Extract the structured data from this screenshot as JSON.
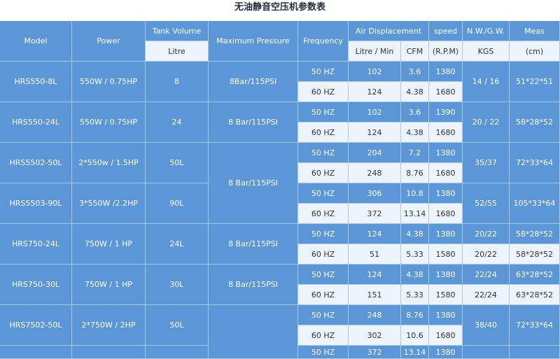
{
  "title": "无油静音空压机参数表",
  "headers": {
    "model": "Model",
    "power": "Power",
    "tank_volume": "Tank Volume",
    "tank_unit": "Litre",
    "max_pressure": "Maximum Pressure",
    "frequency": "Frequency",
    "air_displacement": "Air Displacement",
    "litre_min": "Litre / Min",
    "cfm": "CFM",
    "speed": "speed",
    "speed_unit": "(R.P.M)",
    "weight": "N.W./G.W.",
    "weight_unit": "KGS",
    "meas": "Meas",
    "meas_unit": "(cm)"
  },
  "models": [
    {
      "model": "HRS550-8L",
      "power": "550W / 0.75HP",
      "tank": "8",
      "pressure": "8Bar/115PSI",
      "weight": "14 / 16",
      "meas": "51*22*51"
    },
    {
      "model": "HRS550-24L",
      "power": "550W / 0.75HP",
      "tank": "24",
      "pressure": "8 Bar/115PSI",
      "weight": "20 / 22",
      "meas": "58*28*52"
    },
    {
      "model": "HRS5502-50L",
      "power": "2*550w / 1.5HP",
      "tank": "50L",
      "weight": "35/37",
      "meas": "72*33*64"
    },
    {
      "model": "HRS5503-90L",
      "power": "3*550W /2.2HP",
      "tank": "90L",
      "weight": "52/55",
      "meas": "105*33*64"
    },
    {
      "model": "HRS750-24L",
      "power": "750W / 1 HP",
      "tank": "24L",
      "pressure": "8 Bar/115PSI"
    },
    {
      "model": "HRS750-30L",
      "power": "750W / 1 HP",
      "tank": "30L",
      "pressure": "8 Bar/115PSI"
    },
    {
      "model": "HRS7502-50L",
      "power": "2*750W / 2HP",
      "tank": "50L",
      "weight": "38/40",
      "meas": "72*33*64"
    }
  ],
  "shared_pressure": "8 Bar/115PSI",
  "rows": [
    {
      "freq": "50 HZ",
      "lmin": "102",
      "cfm": "3.6",
      "rpm": "1380"
    },
    {
      "freq": "60 HZ",
      "lmin": "124",
      "cfm": "4.38",
      "rpm": "1680"
    },
    {
      "freq": "50 HZ",
      "lmin": "102",
      "cfm": "3.6",
      "rpm": "1390"
    },
    {
      "freq": "60 HZ",
      "lmin": "124",
      "cfm": "4.38",
      "rpm": "1680"
    },
    {
      "freq": "50 HZ",
      "lmin": "204",
      "cfm": "7.2",
      "rpm": "1380"
    },
    {
      "freq": "60 HZ",
      "lmin": "248",
      "cfm": "8.76",
      "rpm": "1680"
    },
    {
      "freq": "50 HZ",
      "lmin": "306",
      "cfm": "10.8",
      "rpm": "1380"
    },
    {
      "freq": "60 HZ",
      "lmin": "372",
      "cfm": "13.14",
      "rpm": "1680"
    },
    {
      "freq": "50 HZ",
      "lmin": "124",
      "cfm": "4.38",
      "rpm": "1380",
      "weight": "20/22",
      "meas": "58*28*52"
    },
    {
      "freq": "60 HZ",
      "lmin": "51",
      "cfm": "5.33",
      "rpm": "1580",
      "weight": "20/22",
      "meas": "58*28*52"
    },
    {
      "freq": "50 HZ",
      "lmin": "124",
      "cfm": "4.38",
      "rpm": "1380",
      "weight": "22/24",
      "meas": "63*28*52"
    },
    {
      "freq": "60 HZ",
      "lmin": "151",
      "cfm": "5.33",
      "rpm": "1580",
      "weight": "22/24",
      "meas": "63*28*52"
    },
    {
      "freq": "50 HZ",
      "lmin": "248",
      "cfm": "8.76",
      "rpm": "1380"
    },
    {
      "freq": "60 HZ",
      "lmin": "302",
      "cfm": "10.6",
      "rpm": "1680"
    },
    {
      "freq": "50 HZ",
      "lmin": "372",
      "cfm": "13.14",
      "rpm": "1380"
    }
  ]
}
